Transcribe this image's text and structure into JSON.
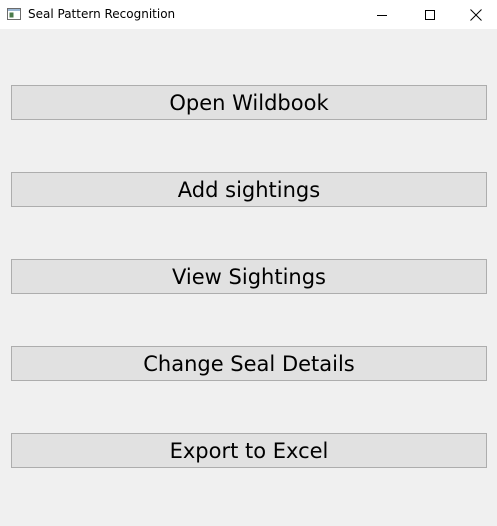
{
  "window": {
    "title": "Seal Pattern Recognition",
    "icons": {
      "app": "app-window-icon",
      "minimize": "minimize-icon",
      "maximize": "maximize-icon",
      "close": "close-icon"
    }
  },
  "menu": {
    "buttons": [
      {
        "label": "Open Wildbook"
      },
      {
        "label": "Add sightings"
      },
      {
        "label": "View Sightings"
      },
      {
        "label": "Change Seal Details"
      },
      {
        "label": "Export to Excel"
      }
    ]
  },
  "colors": {
    "background": "#f0f0f0",
    "titlebar": "#ffffff",
    "button_face": "#e1e1e1",
    "button_border": "#adadad"
  }
}
